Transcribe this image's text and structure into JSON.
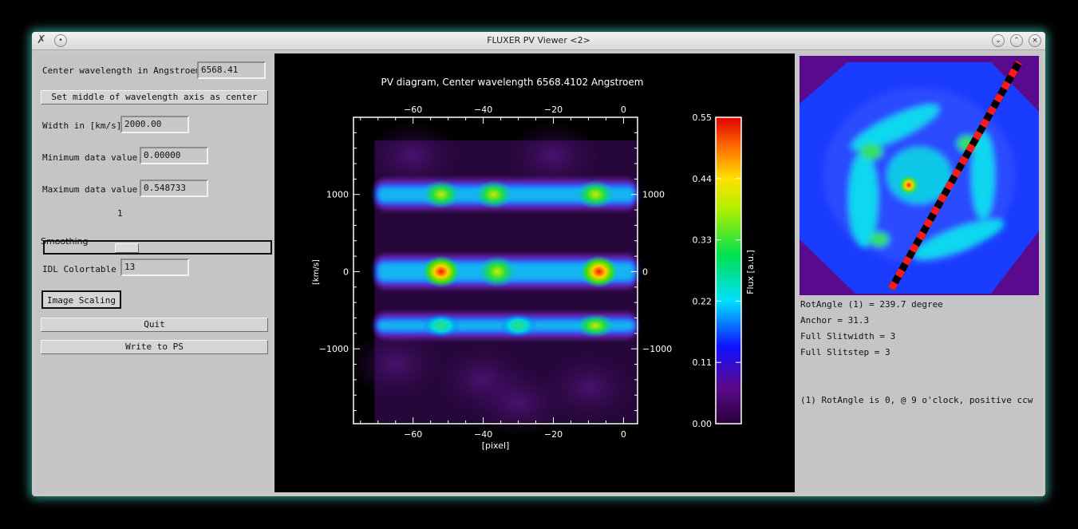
{
  "window": {
    "title": "FLUXER PV Viewer <2>"
  },
  "left_panel": {
    "center_wavelength_label": "Center wavelength in Angstroem",
    "center_wavelength_value": "6568.41",
    "set_middle_button": "Set middle of wavelength axis as center",
    "width_label": "Width in [km/s]",
    "width_value": "2000.00",
    "min_label": "Minimum data value",
    "min_value": "0.00000",
    "max_label": "Maximum data value",
    "max_value": "0.548733",
    "smoothing_value": "1",
    "smoothing_label": "Smoothing",
    "colortable_label": "IDL Colortable",
    "colortable_value": "13",
    "image_scaling_button": "Image Scaling",
    "quit_button": "Quit",
    "write_ps_button": "Write to PS"
  },
  "chart_data": {
    "type": "heatmap",
    "title": "PV diagram, Center wavelength 6568.4102 Angstroem",
    "xlabel": "[pixel]",
    "ylabel": "[km/s]",
    "xlim": [
      -77,
      4
    ],
    "ylim": [
      -1970,
      2000
    ],
    "x_ticks": [
      -60,
      -40,
      -20,
      0
    ],
    "y_ticks": [
      1000,
      0,
      -1000
    ],
    "colorbar": {
      "label": "Flux [a.u.]",
      "ticks": [
        "0.55",
        "0.44",
        "0.33",
        "0.22",
        "0.11",
        "0.00"
      ],
      "range": [
        0.0,
        0.55
      ]
    },
    "bands": [
      {
        "velocity": 1000,
        "blobs": [
          {
            "x": -52,
            "flux": 0.3
          },
          {
            "x": -37,
            "flux": 0.28
          },
          {
            "x": -8,
            "flux": 0.33
          }
        ]
      },
      {
        "velocity": 0,
        "blobs": [
          {
            "x": -52,
            "flux": 0.45
          },
          {
            "x": -36,
            "flux": 0.33
          },
          {
            "x": -7,
            "flux": 0.55
          }
        ]
      },
      {
        "velocity": -700,
        "blobs": [
          {
            "x": -52,
            "flux": 0.26
          },
          {
            "x": -30,
            "flux": 0.2
          },
          {
            "x": -8,
            "flux": 0.28
          }
        ]
      }
    ]
  },
  "right_panel": {
    "info_lines": [
      "RotAngle (1)   = 239.7 degree",
      "Anchor         = 31.3",
      "Full Slitwidth = 3",
      "Full Slitstep  = 3"
    ],
    "footnote": "(1) RotAngle is 0, @ 9 o'clock, positive ccw"
  }
}
